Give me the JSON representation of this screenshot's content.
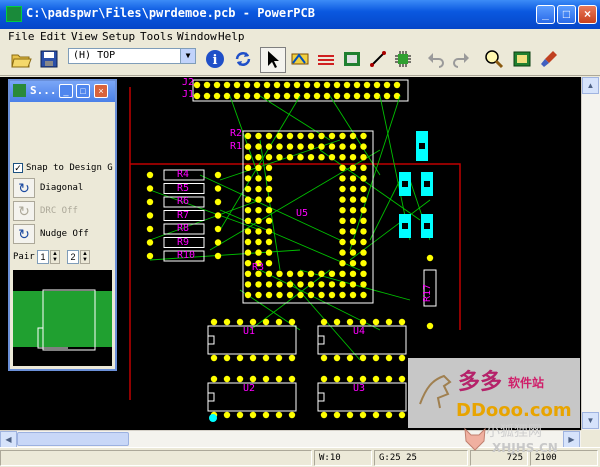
{
  "window": {
    "title": "C:\\padspwr\\Files\\pwrdemoe.pcb - PowerPCB",
    "min_label": "_",
    "max_label": "□",
    "close_label": "×"
  },
  "menu": [
    "File",
    "Edit",
    "View",
    "Setup",
    "Tools",
    "Window",
    "Help"
  ],
  "toolbar": {
    "layer_select": "(H) TOP",
    "icons": [
      "open-icon",
      "save-icon",
      "layer-select",
      "info-icon",
      "refresh-icon",
      "select-arrow-icon",
      "drafting-icon",
      "design-icon",
      "ecc-icon",
      "route-icon",
      "component-icon",
      "undo-icon",
      "redo-icon",
      "zoom-icon",
      "cam-icon",
      "clean-icon"
    ]
  },
  "palette": {
    "title": "S...",
    "snap_label": "Snap to Design G",
    "snap_checked": "✓",
    "diagonal_label": "Diagonal",
    "drc_label": "DRC Off",
    "nudge_label": "Nudge Off",
    "pair_label": "Pair",
    "pair_value_1": "1",
    "pair_value_2": "2"
  },
  "pcb": {
    "connectors": [
      "J2",
      "J1"
    ],
    "resistors": [
      "R4",
      "R5",
      "R6",
      "R7",
      "R8",
      "R9",
      "R10"
    ],
    "chip_labels": [
      "R2",
      "R1",
      "U5",
      "R3",
      "R17"
    ],
    "ics": [
      "U1",
      "U4",
      "U2",
      "U3"
    ]
  },
  "status": {
    "width": "W:10",
    "grid": "G:25 25",
    "x": "725",
    "y": "2100"
  },
  "watermark": {
    "brand": "多多",
    "tag": "软件站",
    "url": "DDooo.com",
    "site2": "小狐狸网",
    "url2": "XHJHS.CN"
  },
  "colors": {
    "board_bg": "#000000",
    "pad": "#ffff00",
    "silk": "#ffffff",
    "label": "#ff00ff",
    "ratsnest": "#00c000",
    "smd": "#00ffff",
    "outline": "#c00000"
  }
}
